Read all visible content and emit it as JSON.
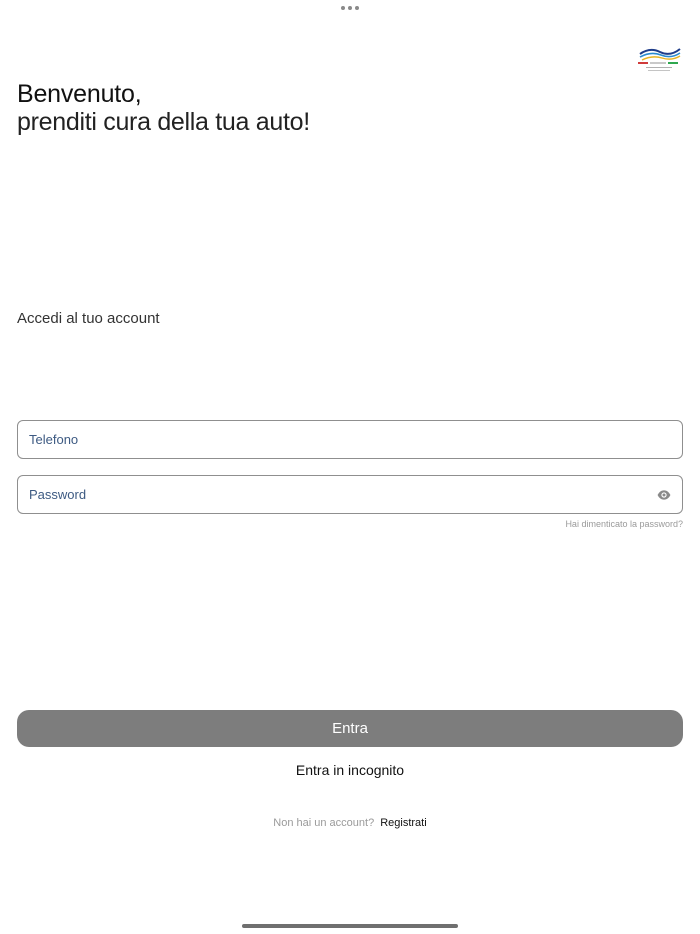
{
  "header": {
    "welcome": "Benvenuto,",
    "tagline": "prenditi cura della tua auto!"
  },
  "login": {
    "subtitle": "Accedi al tuo account",
    "phone_placeholder": "Telefono",
    "password_placeholder": "Password",
    "forgot_password": "Hai dimenticato la password?",
    "submit_label": "Entra",
    "incognito_label": "Entra in incognito",
    "signup_question": "Non hai un account?",
    "signup_link": "Registrati"
  },
  "icons": {
    "password_toggle": "eye-icon",
    "logo": "brand-logo"
  },
  "colors": {
    "button_bg": "#7d7d7d",
    "input_text": "#3d5a82",
    "muted_text": "#9a9a9a"
  }
}
